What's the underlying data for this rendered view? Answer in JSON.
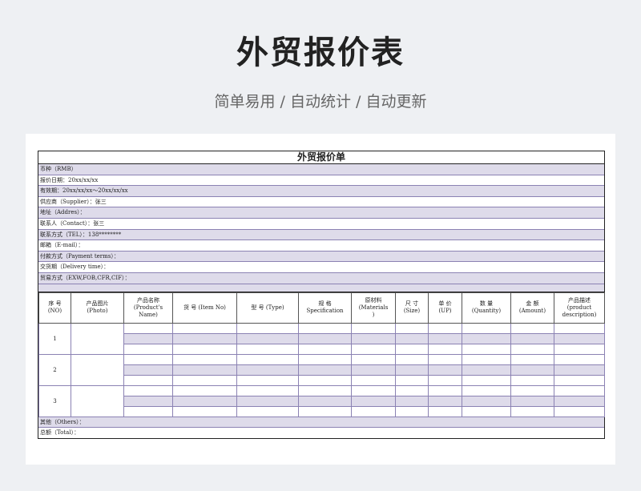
{
  "header": {
    "title": "外贸报价表",
    "subtitle": "简单易用 / 自动统计 / 自动更新"
  },
  "sheet": {
    "title": "外贸报价单",
    "info_rows": [
      "币种（RMB）",
      "报价日期：20xx/xx/xx",
      "有效期：20xx/xx/xx～20xx/xx/xx",
      "供应商（Supplier）：张三",
      "地址（Addres）：",
      "联系人（Contact）：张三",
      "联系方式（TEL）：138********",
      "邮箱（E-mail）：",
      "付款方式（Payment terms）：",
      "交货期（Delivery time）：",
      "贸易方式（EXW,FOB,CFR,CIF）："
    ],
    "columns": [
      "序 号\n(NO)",
      "产品图片\n(Photo)",
      "产品名称\n(Product's\nName)",
      "货 号 (Item No)",
      "型 号 (Type)",
      "规 格\nSpecification",
      "原材料\n(Materials\n)",
      "尺 寸\n(Size)",
      "单 价\n(UP)",
      "数 量\n(Quantity)",
      "金 额\n(Amount)",
      "产品描述\n(product\ndescription)"
    ],
    "items": [
      {
        "no": "1"
      },
      {
        "no": "2"
      },
      {
        "no": "3"
      }
    ],
    "footer": {
      "others": "其他（Others）：",
      "total": "总额（Total）："
    }
  }
}
